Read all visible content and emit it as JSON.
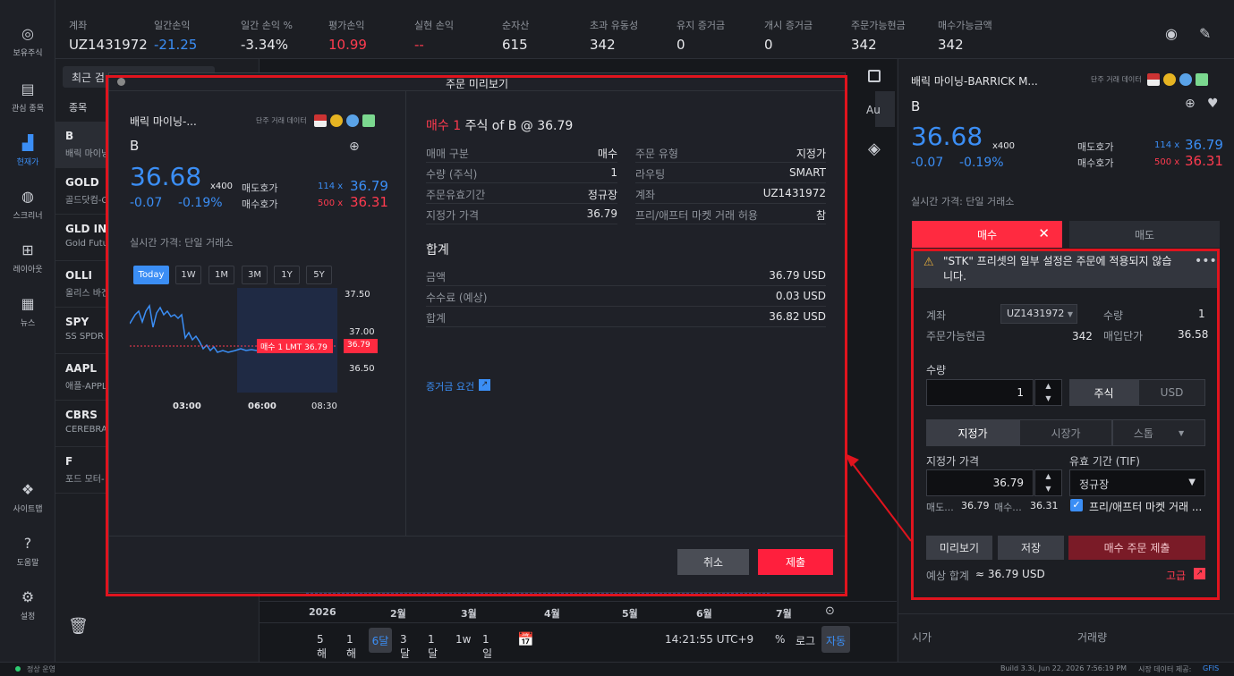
{
  "sidebar": {
    "items": [
      {
        "label": "보유주식"
      },
      {
        "label": "관심 종목"
      },
      {
        "label": "현재가"
      },
      {
        "label": "스크리너"
      },
      {
        "label": "레이아웃"
      },
      {
        "label": "뉴스"
      },
      {
        "label": "사이트맵"
      },
      {
        "label": "도움말"
      },
      {
        "label": "설정"
      }
    ]
  },
  "topbar": {
    "stats": [
      {
        "label": "계좌",
        "value": "UZ1431972"
      },
      {
        "label": "일간손익",
        "value": "-21.25"
      },
      {
        "label": "일간 손익 %",
        "value": "-3.34%"
      },
      {
        "label": "평가손익",
        "value": "10.99"
      },
      {
        "label": "실현 손익",
        "value": "--"
      },
      {
        "label": "순자산",
        "value": "615"
      },
      {
        "label": "초과 유동성",
        "value": "342"
      },
      {
        "label": "유지 증거금",
        "value": "0"
      },
      {
        "label": "개시 증거금",
        "value": "0"
      },
      {
        "label": "주문가능현금",
        "value": "342"
      },
      {
        "label": "매수가능금액",
        "value": "342"
      }
    ]
  },
  "watchlist": {
    "search_label": "최근 검",
    "header": "종목",
    "rows": [
      {
        "symbol": "B",
        "name": "배릭 마이닝"
      },
      {
        "symbol": "GOLD",
        "name": "골드닷컴-C"
      },
      {
        "symbol": "GLD IND",
        "name": "Gold Futu"
      },
      {
        "symbol": "OLLI",
        "name": "올리스 바겐"
      },
      {
        "symbol": "SPY",
        "name": "SS SPDR S"
      },
      {
        "symbol": "AAPL",
        "name": "애플-APPL"
      },
      {
        "symbol": "CBRS",
        "name": "CEREBRAS"
      },
      {
        "symbol": "F",
        "name": "포드 모터-"
      }
    ]
  },
  "chart": {
    "au_label": "Au",
    "months": [
      "2026",
      "2월",
      "3월",
      "4월",
      "5월",
      "6월",
      "7월"
    ],
    "periods": [
      "5해",
      "1해",
      "6달",
      "3달",
      "1달",
      "1w",
      "1일"
    ],
    "time": "14:21:55 UTC+9",
    "pct": "%",
    "log": "로그",
    "auto": "자동"
  },
  "right": {
    "title": "배릭 마이닝-BARRICK M...",
    "data_label": "단주 거래 데이터",
    "symbol": "B",
    "price": "36.68",
    "mult": "x400",
    "change": "-0.07",
    "change_pct": "-0.19%",
    "ask_label": "매도호가",
    "bid_label": "매수호가",
    "ask_size": "114",
    "ask": "36.79",
    "bid_size": "500",
    "bid": "36.31",
    "realtime": "실시간 가격: 단일 거래소",
    "buy_tab": "매수",
    "sell_tab": "매도",
    "warning": "\"STK\" 프리셋의 일부 설정은 주문에 적용되지 않습니다.",
    "account_label": "계좌",
    "account": "UZ1431972",
    "qty_label": "수량",
    "qty_val": "1",
    "cash_label": "주문가능현금",
    "cash": "342",
    "avg_label": "매입단가",
    "avg": "36.58",
    "quantity_label": "수량",
    "quantity": "1",
    "shares": "주식",
    "usd": "USD",
    "limit": "지정가",
    "market": "시장가",
    "stop": "스톱",
    "lmt_price_label": "지정가 가격",
    "lmt_price": "36.79",
    "tif_label": "유효 기간 (TIF)",
    "tif": "정규장",
    "ask_short": "매도...",
    "ask_short_v": "36.79",
    "bid_short": "매수...",
    "bid_short_v": "36.31",
    "outside_rth": "프리/애프터 마켓 거래 ...",
    "preview": "미리보기",
    "save": "저장",
    "submit": "매수 주문 제출",
    "est_label": "예상 합계",
    "est": "≈ 36.79 USD",
    "advanced": "고급",
    "open_label": "시가",
    "volume_label": "거래량"
  },
  "modal": {
    "title": "주문 미리보기",
    "name": "배릭 마이닝-...",
    "data_label": "단주 거래 데이터",
    "symbol": "B",
    "price": "36.68",
    "mult": "x400",
    "change": "-0.07",
    "change_pct": "-0.19%",
    "ask_label": "매도호가",
    "bid_label": "매수호가",
    "ask_size": "114",
    "ask": "36.79",
    "bid_size": "500",
    "bid": "36.31",
    "realtime": "실시간 가격: 단일 거래소",
    "periods": [
      "Today",
      "1W",
      "1M",
      "3M",
      "1Y",
      "5Y"
    ],
    "yticks": [
      "37.50",
      "37.00",
      "36.50"
    ],
    "xticks": [
      "03:00",
      "06:00",
      "08:30"
    ],
    "order_tag": "매수 1 LMT 36.79",
    "price_tag": "36.79",
    "order_head_buy": "매수 1",
    "order_head_rest": "주식 of B @ 36.79",
    "details_left": [
      {
        "k": "매매 구분",
        "v": "매수"
      },
      {
        "k": "수량 (주식)",
        "v": "1"
      },
      {
        "k": "주문유효기간",
        "v": "정규장"
      },
      {
        "k": "지정가 가격",
        "v": "36.79"
      }
    ],
    "details_right": [
      {
        "k": "주문 유형",
        "v": "지정가"
      },
      {
        "k": "라우팅",
        "v": "SMART"
      },
      {
        "k": "계좌",
        "v": "UZ1431972"
      },
      {
        "k": "프리/애프터 마켓 거래 허용",
        "v": "참"
      }
    ],
    "total_title": "합계",
    "totals": [
      {
        "k": "금액",
        "v": "36.79 USD"
      },
      {
        "k": "수수료 (예상)",
        "v": "0.03 USD"
      },
      {
        "k": "합계",
        "v": "36.82 USD"
      }
    ],
    "margin_link": "증거금 요건",
    "cancel": "취소",
    "submit": "제출"
  },
  "status": {
    "left": "정상 운영",
    "build": "Build 3.3i, Jun 22, 2026 7:56:19 PM",
    "provider_label": "시장 데이터 제공:",
    "provider": "GFIS"
  },
  "colors": {
    "accent": "#3b8ef5",
    "buy": "#ff2a40",
    "bg": "#1b1d22"
  }
}
